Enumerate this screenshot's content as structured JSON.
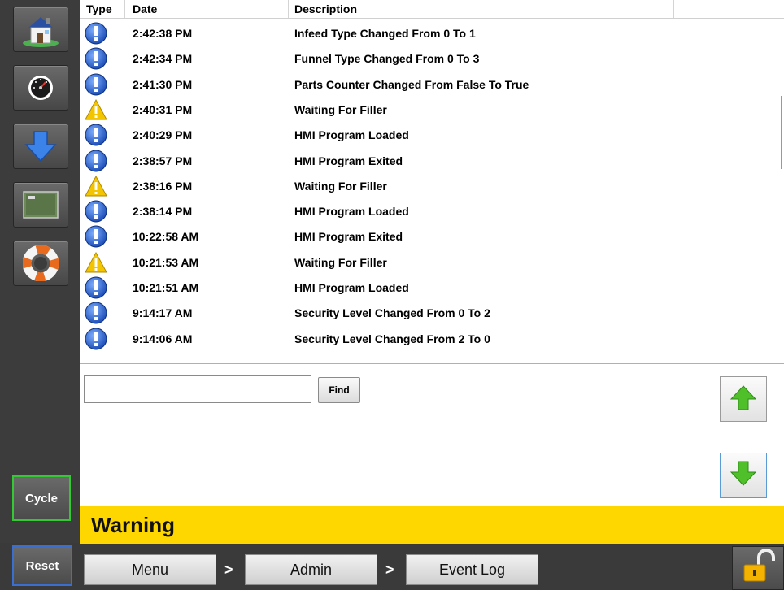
{
  "log": {
    "columns": {
      "type": "Type",
      "date": "Date",
      "description": "Description"
    },
    "rows": [
      {
        "icon": "info-icon",
        "date": "2:42:38 PM",
        "description": "Infeed Type Changed From 0 To 1"
      },
      {
        "icon": "info-icon",
        "date": "2:42:34 PM",
        "description": "Funnel Type Changed From 0 To 3"
      },
      {
        "icon": "info-icon",
        "date": "2:41:30 PM",
        "description": "Parts Counter Changed From False To True"
      },
      {
        "icon": "warning-icon",
        "date": "2:40:31 PM",
        "description": "Waiting For Filler"
      },
      {
        "icon": "info-icon",
        "date": "2:40:29 PM",
        "description": "HMI Program Loaded"
      },
      {
        "icon": "info-icon",
        "date": "2:38:57 PM",
        "description": "HMI Program Exited"
      },
      {
        "icon": "warning-icon",
        "date": "2:38:16 PM",
        "description": "Waiting For Filler"
      },
      {
        "icon": "info-icon",
        "date": "2:38:14 PM",
        "description": "HMI Program Loaded"
      },
      {
        "icon": "info-icon",
        "date": "10:22:58 AM",
        "description": "HMI Program Exited"
      },
      {
        "icon": "warning-icon",
        "date": "10:21:53 AM",
        "description": "Waiting For Filler"
      },
      {
        "icon": "info-icon",
        "date": "10:21:51 AM",
        "description": "HMI Program Loaded"
      },
      {
        "icon": "info-icon",
        "date": "9:14:17 AM",
        "description": "Security Level Changed From 0 To 2"
      },
      {
        "icon": "info-icon",
        "date": "9:14:06 AM",
        "description": "Security Level Changed From 2 To 0"
      }
    ]
  },
  "search": {
    "value": "",
    "find_label": "Find"
  },
  "sidebar": {
    "icons": [
      "home-icon",
      "gauge-icon",
      "download-arrow-icon",
      "cpu-chip-icon",
      "lifebuoy-icon"
    ],
    "cycle_label": "Cycle",
    "reset_label": "Reset"
  },
  "status": {
    "warning_text": "Warning",
    "warning_color": "#ffd700"
  },
  "breadcrumb": {
    "items": [
      "Menu",
      "Admin",
      "Event Log"
    ],
    "separator": ">"
  },
  "colors": {
    "info": "#1e4fb8",
    "warning": "#f2c500",
    "cycle_border": "#35c835",
    "reset_border": "#3a6fd0"
  }
}
